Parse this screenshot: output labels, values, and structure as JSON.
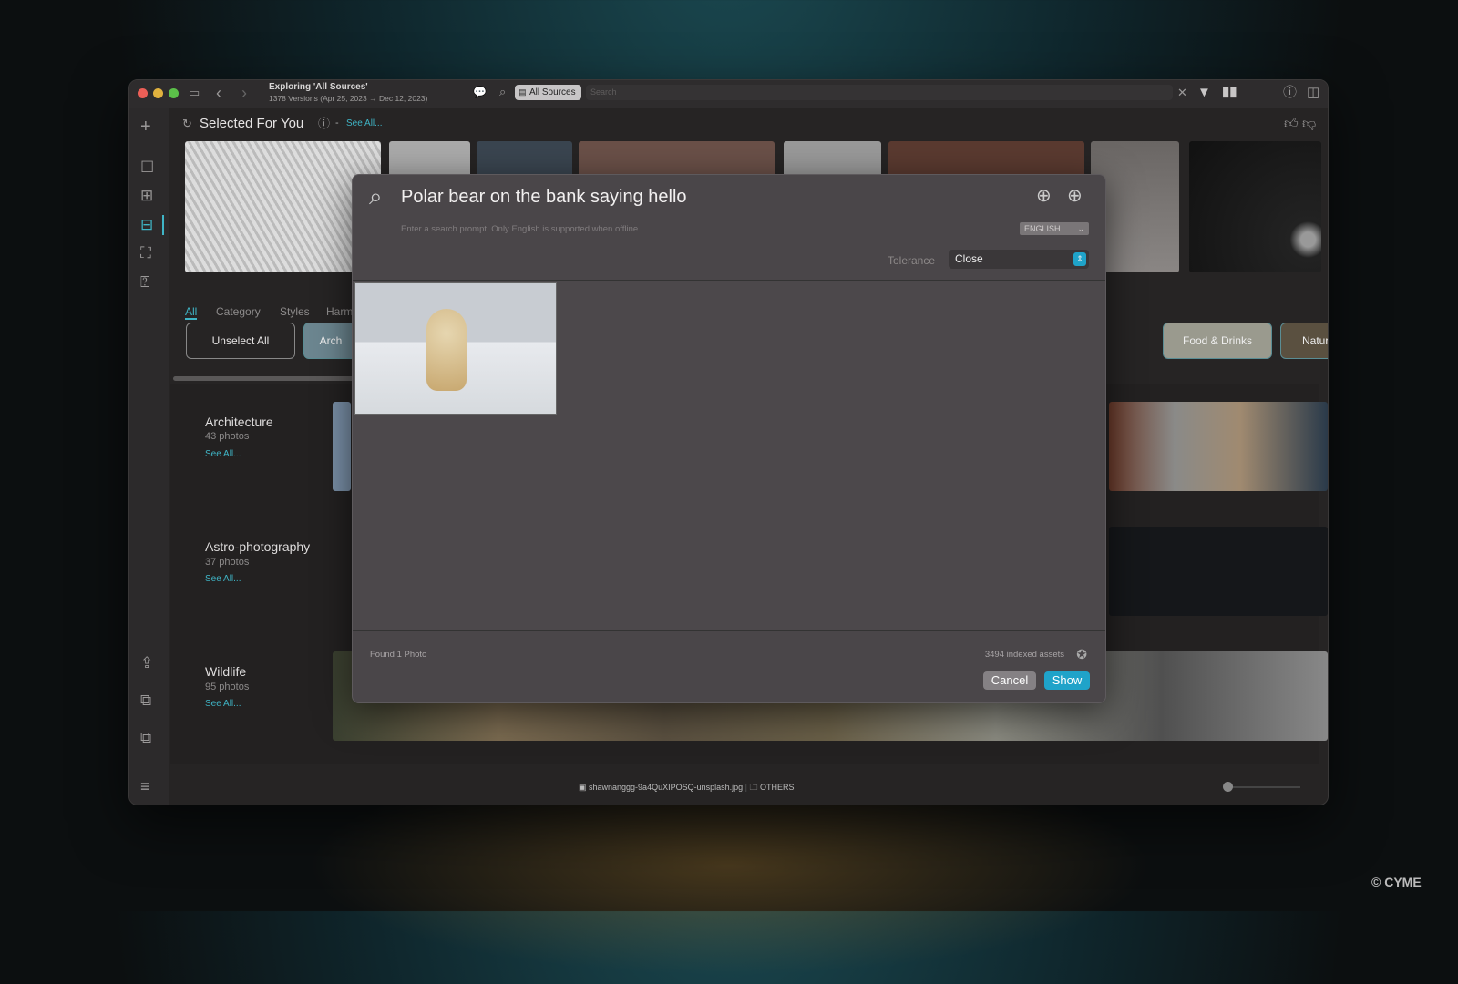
{
  "window": {
    "title": "Exploring 'All Sources'",
    "subtitle": "1378 Versions (Apr 25, 2023 → Dec 12, 2023)",
    "source_chip": "All Sources",
    "search_placeholder": "Search"
  },
  "section": {
    "title": "Selected For You",
    "separator": "-",
    "see_all": "See All..."
  },
  "tabs": [
    {
      "label": "All",
      "active": true
    },
    {
      "label": "Category"
    },
    {
      "label": "Styles"
    },
    {
      "label": "Harm"
    }
  ],
  "chips": {
    "unselect": "Unselect All",
    "items": [
      "Arch",
      "Food & Drinks",
      "Nature"
    ]
  },
  "categories": [
    {
      "name": "Architecture",
      "count": "43 photos",
      "see_all": "See All..."
    },
    {
      "name": "Astro-photography",
      "count": "37 photos",
      "see_all": "See All..."
    },
    {
      "name": "Wildlife",
      "count": "95 photos",
      "see_all": "See All..."
    }
  ],
  "dialog": {
    "query": "Polar bear on the bank saying hello",
    "hint": "Enter a search prompt. Only English is supported when offline.",
    "language": "ENGLISH",
    "tolerance_label": "Tolerance",
    "tolerance_value": "Close",
    "found": "Found 1 Photo",
    "indexed": "3494 indexed assets",
    "cancel": "Cancel",
    "show": "Show"
  },
  "status": {
    "filename": "shawnanggg-9a4QuXIPOSQ-unsplash.jpg",
    "folder": "OTHERS"
  },
  "watermark": "© CYME",
  "colors": {
    "accent": "#3fb5c6",
    "show_button": "#1fa3c9"
  }
}
